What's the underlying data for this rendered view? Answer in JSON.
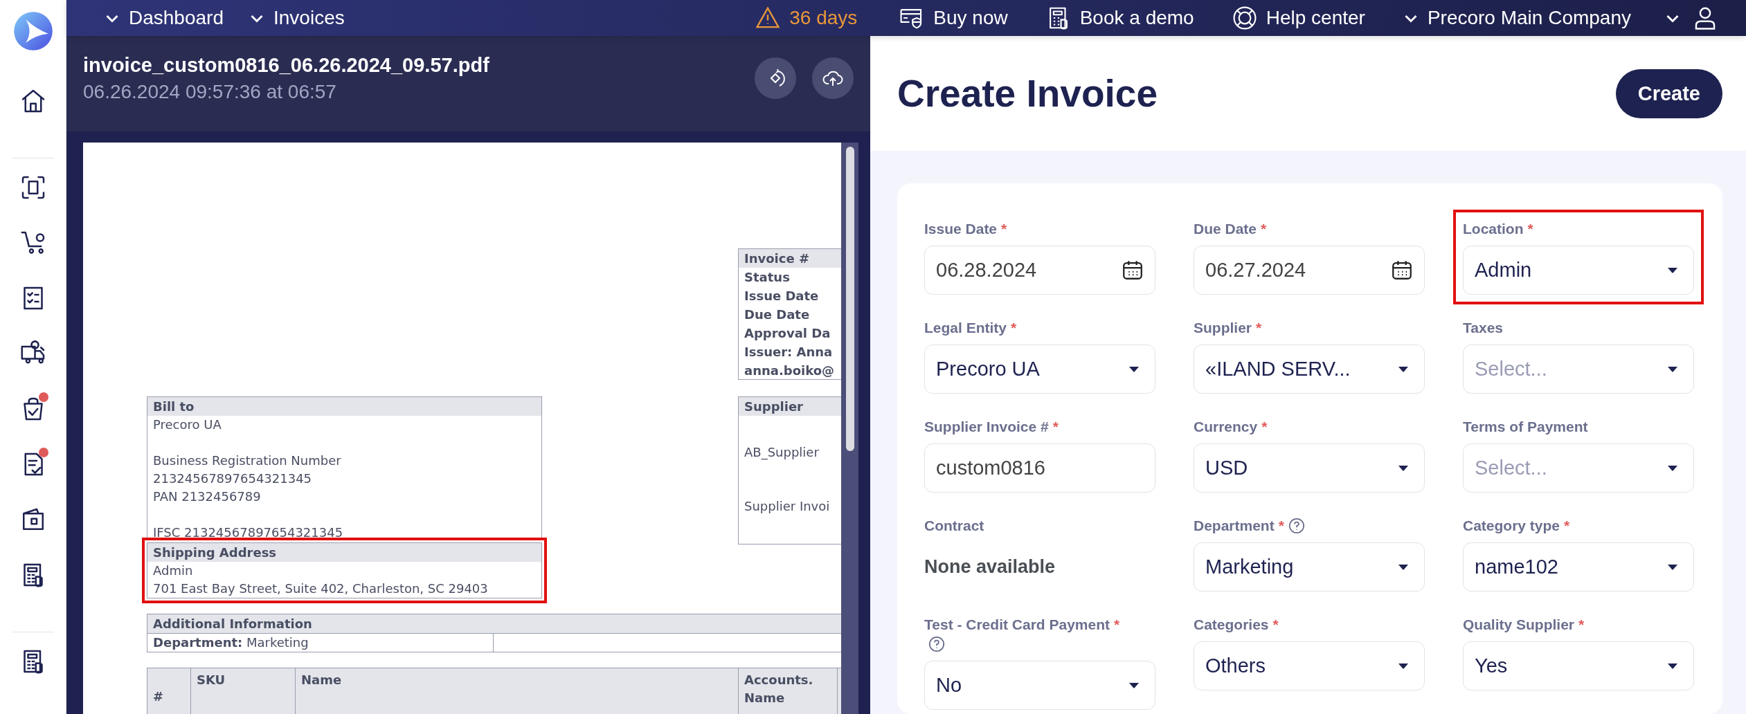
{
  "sidebar": {
    "items": [
      {
        "kind": "home",
        "notification": false
      },
      {
        "kind": "scan",
        "notification": false
      },
      {
        "kind": "cart",
        "notification": false
      },
      {
        "kind": "checklist",
        "notification": false
      },
      {
        "kind": "truck",
        "notification": false
      },
      {
        "kind": "bag",
        "notification": true
      },
      {
        "kind": "document",
        "notification": true
      },
      {
        "kind": "wallet",
        "notification": false
      },
      {
        "kind": "calculator",
        "notification": false
      },
      {
        "kind": "calculator",
        "notification": false
      }
    ]
  },
  "top_bar": {
    "breadcrumbs": [
      "Dashboard",
      "Invoices"
    ],
    "trial": "36 days",
    "links": [
      {
        "kind": "card",
        "label": "Buy now"
      },
      {
        "kind": "calculator",
        "label": "Book a demo"
      },
      {
        "kind": "lifebuoy",
        "label": "Help center"
      }
    ],
    "company": "Precoro Main Company"
  },
  "document_viewer": {
    "file_name": "invoice_custom0816_06.26.2024_09.57.pdf",
    "timestamp": "06.26.2024 09:57:36 at 06:57",
    "invoice_box": [
      "Invoice #",
      "Status",
      "Issue Date",
      "Due Date",
      "Approval Da",
      "Issuer: Anna",
      "anna.boiko@"
    ],
    "bill_to": {
      "heading": "Bill to",
      "groups": [
        [
          "Precoro UA"
        ],
        [
          "Business Registration Number",
          "21324567897654321345",
          "PAN 2132456789"
        ],
        [
          "IFSC 21324567897654321345"
        ]
      ]
    },
    "supplier": {
      "heading": "Supplier",
      "lines": [
        "AB_Supplier",
        "Supplier Invoi"
      ]
    },
    "shipping": {
      "heading": "Shipping Address",
      "lines": [
        "Admin",
        "701 East Bay Street, Suite 402, Charleston, SC 29403"
      ],
      "highlighted": true
    },
    "additional": {
      "heading": "Additional Information",
      "row": "**Department:** Marketing"
    },
    "table_columns": [
      "#",
      "SKU",
      "Name",
      "Accounts. Name"
    ]
  },
  "form": {
    "title": "Create Invoice",
    "create_button": "Create",
    "fields": [
      {
        "label": "Issue Date",
        "required_mark": "*",
        "kind": "date",
        "value": "06.28.2024"
      },
      {
        "label": "Due Date",
        "required_mark": "*",
        "kind": "date",
        "value": "06.27.2024"
      },
      {
        "label": "Location",
        "required_mark": "*",
        "kind": "select",
        "value": "Admin",
        "highlighted": true
      },
      {
        "label": "Legal Entity",
        "required_mark": "*",
        "kind": "select",
        "value": "Precoro UA"
      },
      {
        "label": "Supplier",
        "required_mark": "*",
        "kind": "select",
        "value": "«ILAND SERV..."
      },
      {
        "label": "Taxes",
        "kind": "select",
        "placeholder": "Select..."
      },
      {
        "label": "Supplier Invoice #",
        "required_mark": "*",
        "kind": "text",
        "value": "custom0816"
      },
      {
        "label": "Currency",
        "required_mark": "*",
        "kind": "select",
        "value": "USD"
      },
      {
        "label": "Terms of Payment",
        "kind": "select",
        "placeholder": "Select..."
      },
      {
        "label": "Contract",
        "kind": "static",
        "value": "None available"
      },
      {
        "label": "Department",
        "required_mark": "*",
        "help": true,
        "kind": "select",
        "value": "Marketing"
      },
      {
        "label": "Category type",
        "required_mark": "*",
        "kind": "select",
        "value": "name102"
      },
      {
        "label": "Test - Credit Card Payment",
        "required_mark": "*",
        "help": true,
        "kind": "select",
        "value": "No"
      },
      {
        "label": "Categories",
        "required_mark": "*",
        "kind": "select",
        "value": "Others"
      },
      {
        "label": "Quality Supplier",
        "required_mark": "*",
        "kind": "select",
        "value": "Yes"
      }
    ]
  }
}
